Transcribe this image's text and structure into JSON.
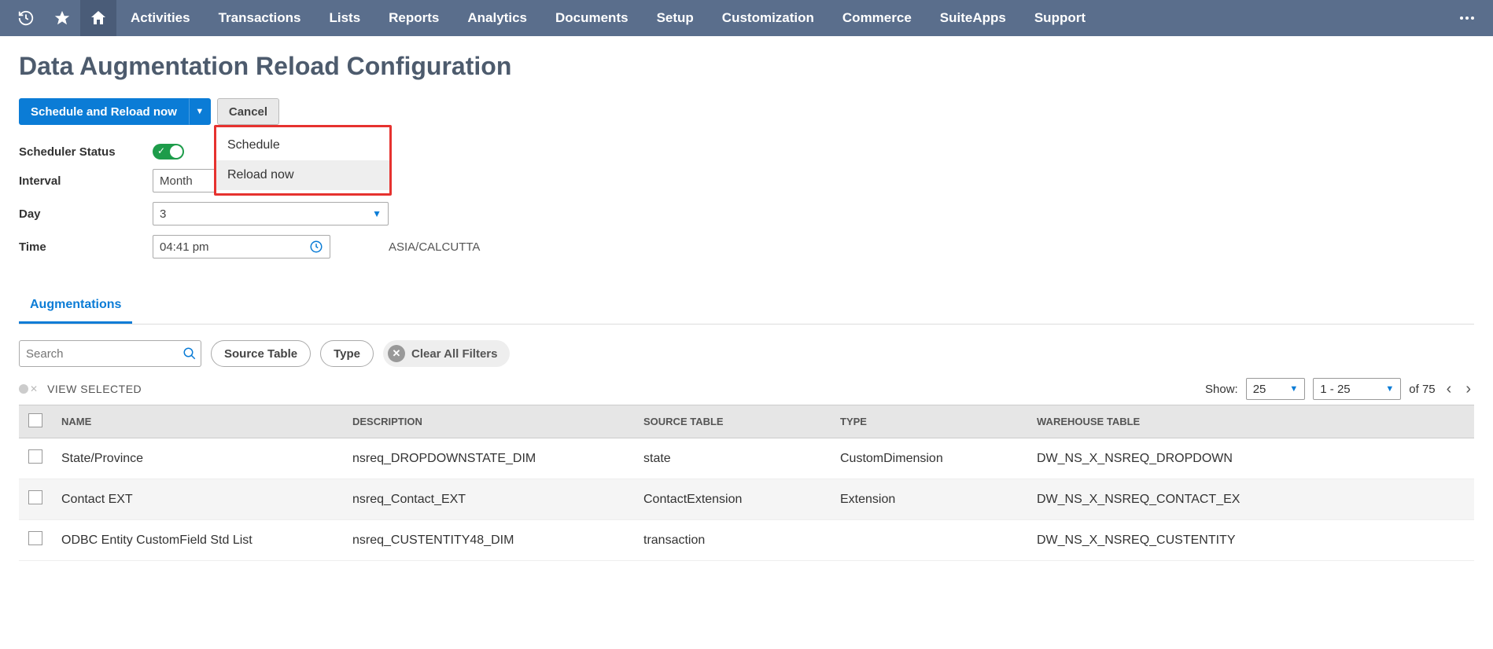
{
  "nav": {
    "items": [
      "Activities",
      "Transactions",
      "Lists",
      "Reports",
      "Analytics",
      "Documents",
      "Setup",
      "Customization",
      "Commerce",
      "SuiteApps",
      "Support"
    ]
  },
  "page": {
    "title": "Data Augmentation Reload Configuration"
  },
  "buttons": {
    "primary": "Schedule and Reload now",
    "cancel": "Cancel",
    "dropdown": {
      "item0": "Schedule",
      "item1": "Reload now"
    }
  },
  "form": {
    "scheduler_status_label": "Scheduler Status",
    "interval_label": "Interval",
    "interval_value": "Month",
    "day_label": "Day",
    "day_value": "3",
    "time_label": "Time",
    "time_value": "04:41 pm",
    "timezone": "ASIA/CALCUTTA"
  },
  "tabs": {
    "augmentations": "Augmentations"
  },
  "filters": {
    "search_placeholder": "Search",
    "source_table": "Source Table",
    "type": "Type",
    "clear": "Clear All Filters",
    "view_selected": "VIEW SELECTED"
  },
  "pager": {
    "show_label": "Show:",
    "page_size": "25",
    "range": "1 - 25",
    "of_total": "of 75"
  },
  "table": {
    "headers": {
      "name": "NAME",
      "description": "DESCRIPTION",
      "source_table": "SOURCE TABLE",
      "type": "TYPE",
      "warehouse_table": "WAREHOUSE TABLE"
    },
    "rows": [
      {
        "name": "State/Province",
        "description": "nsreq_DROPDOWNSTATE_DIM",
        "source": "state",
        "type": "CustomDimension",
        "warehouse": "DW_NS_X_NSREQ_DROPDOWN"
      },
      {
        "name": "Contact EXT",
        "description": "nsreq_Contact_EXT",
        "source": "ContactExtension",
        "type": "Extension",
        "warehouse": "DW_NS_X_NSREQ_CONTACT_EX"
      },
      {
        "name": "ODBC Entity CustomField Std List",
        "description": "nsreq_CUSTENTITY48_DIM",
        "source": "transaction",
        "type": "",
        "warehouse": "DW_NS_X_NSREQ_CUSTENTITY"
      }
    ]
  }
}
